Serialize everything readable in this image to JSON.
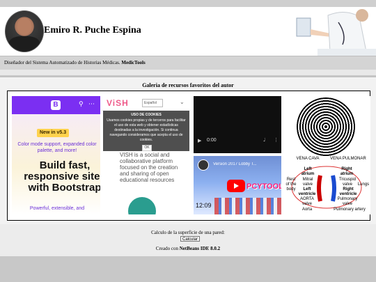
{
  "header": {
    "author_name": "Emiro R. Puche Espina",
    "subtitle_prefix": "Diseñador del Sistema Automatizado de Historias Médicas.",
    "subtitle_brand": "MedicTools"
  },
  "gallery": {
    "title": "Galeria de recursos favoritos del autor",
    "bootstrap": {
      "badge": "New in v5.3",
      "lead": "Color mode support, expanded color palette, and more!",
      "headline": "Build fast, responsive sites with Bootstrap",
      "footer": "Powerful, extensible, and",
      "icons": [
        "bootstrap-logo",
        "search-icon",
        "more-icon"
      ]
    },
    "vish": {
      "logo": "ViSH",
      "lang": "Español",
      "cookie_title": "USO DE COOKIES",
      "cookie_body": "Usamos cookies propias y de terceros para facilitar el uso de esta web y obtener estadísticas destinadas a la investigación. Si continua navegando consideramos que acepta el uso de cookies.",
      "ok_label": "OK",
      "description": "VISH is a social and collaborative platform focused on the creation and sharing of open educational resources"
    },
    "video": {
      "time": "0:00"
    },
    "youtube": {
      "title": "Version 2017 Lobby T...",
      "brand": "PCYTOOLS",
      "clock": "12:09"
    },
    "heart": {
      "vena_cava": "VENA CAVA",
      "vena_pulmonar": "VENA PULMONAR",
      "left_atrium": "Left atrium",
      "right_atrium": "Right atrium",
      "mitral": "Mitral valve",
      "tricuspid": "Tricuspid valve",
      "left_ventricle": "Left ventricle",
      "right_ventricle": "Right ventricle",
      "rest": "Rest of the body",
      "lungs": "Lungs",
      "aorta_upper": "AORTA valve",
      "pulmonary_valve": "Pulmonary valve",
      "aorta": "Aorta",
      "pulmonary_artery": "Pulmonary artery"
    }
  },
  "footer": {
    "calc_text": "Calculo de la superficie de una pared:",
    "calc_button": "Calcular",
    "credit_prefix": "Creado con",
    "credit_tool": "NetBeans IDE 8.0.2"
  },
  "colors": {
    "bootstrap_purple": "#7b2ff2",
    "vish_pink": "#ef5b8a",
    "youtube_red": "#ff0000"
  }
}
